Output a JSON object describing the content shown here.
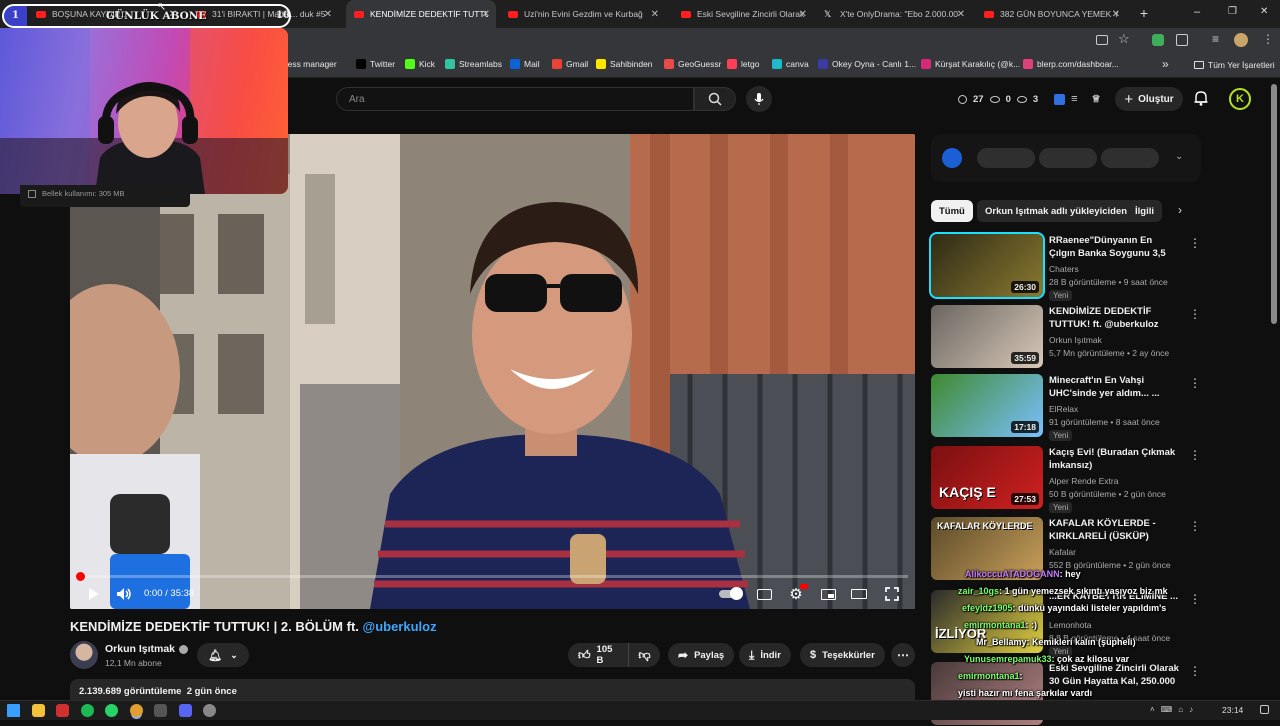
{
  "browser": {
    "tabs": [
      {
        "label": "BOŞUNA KAYDIR..."
      },
      {
        "label": "31'i BIRAKTI | Madal... duk #5"
      },
      {
        "label": "KENDİMİZE DEDEKTİF TUTTUK"
      },
      {
        "label": "Uzi'nin Evini Gezdim ve Kurbağ"
      },
      {
        "label": "Eski Sevgiline Zincirli Olarak 30"
      },
      {
        "label": "X'te OnlyDrama: \"Ebo 2.000.00"
      },
      {
        "label": "382 GÜN BOYUNCA YEMEK YE"
      }
    ],
    "new_tab": "+",
    "window_controls": {
      "minimize": "–",
      "restore": "❐",
      "close": "✕"
    },
    "bookmarks": [
      {
        "label": "usiness manager",
        "icon": "business-icon",
        "color": "#4a4a4a"
      },
      {
        "label": "Twitter",
        "icon": "x-icon",
        "color": "#000000"
      },
      {
        "label": "Kick",
        "icon": "kick-icon",
        "color": "#53fc18"
      },
      {
        "label": "Streamlabs",
        "icon": "streamlabs-icon",
        "color": "#31c3a2"
      },
      {
        "label": "Mail",
        "icon": "mail-icon",
        "color": "#0a64d6"
      },
      {
        "label": "Gmail",
        "icon": "gmail-icon",
        "color": "#ea4335"
      },
      {
        "label": "Sahibinden",
        "icon": "sahibinden-icon",
        "color": "#ffe800"
      },
      {
        "label": "GeoGuessr",
        "icon": "geoguessr-icon",
        "color": "#e94a4a"
      },
      {
        "label": "letgo",
        "icon": "letgo-icon",
        "color": "#ff3f55"
      },
      {
        "label": "canva",
        "icon": "canva-icon",
        "color": "#20b8cd"
      },
      {
        "label": "Okey Oyna - Canlı 1...",
        "icon": "okey-icon",
        "color": "#3a3aa0"
      },
      {
        "label": "Kürşat Karakılıç (@k...",
        "icon": "instagram-icon",
        "color": "#d62976"
      },
      {
        "label": "blerp.com/dashboar...",
        "icon": "blerp-icon",
        "color": "#e0407a"
      }
    ],
    "bookmarks_more": "»",
    "all_bookmarks": "Tüm Yer İşaretleri"
  },
  "overlay": {
    "banner_left_num": "1",
    "banner_text": "GÜNLÜK ABONE",
    "banner_right_num": "10",
    "memory_text": "Bellek kullanımı: 305 MB"
  },
  "youtube": {
    "search_placeholder": "Ara",
    "stats": {
      "a": "27",
      "b": "0",
      "c": "3"
    },
    "create_label": "Oluştur",
    "avatar_letter": "K",
    "player": {
      "time": "0:00 / 35:38",
      "progress": 0.0
    },
    "title_main": "KENDİMİZE DEDEKTİF TUTTUK! | 2. BÖLÜM ft. ",
    "title_mention": "@uberkuloz",
    "channel": {
      "name": "Orkun Işıtmak",
      "subs": "12,1 Mn abone"
    },
    "actions": {
      "likes": "105 B",
      "share": "Paylaş",
      "download": "İndir",
      "thanks": "Teşekkürler"
    },
    "description_meta": "2.139.689 görüntüleme  2 gün önce",
    "chips": [
      "Tümü",
      "Orkun Işıtmak adlı yükleyiciden",
      "İlgili"
    ],
    "recommendations": [
      {
        "title": "RRaenee\"Dünyanın En Çılgın Banka Soygunu 3,5 Ton Para ...",
        "channel": "Chaters",
        "meta": "28 B görüntüleme • 9 saat önce",
        "badge": "Yeni",
        "duration": "26:30",
        "colors": [
          "#2e2a16",
          "#8a7a30"
        ]
      },
      {
        "title": "KENDİMİZE DEDEKTİF TUTTUK! ft. @uberkuloz",
        "channel": "Orkun Işıtmak",
        "meta": "5,7 Mn görüntüleme • 2 ay önce",
        "badge": "",
        "duration": "35:59",
        "colors": [
          "#6b6560",
          "#d8c9b8"
        ]
      },
      {
        "title": "Minecraft'ın En Vahşi UHC'sinde yer aldım... ...",
        "channel": "ElRelax",
        "meta": "91 görüntüleme • 8 saat önce",
        "badge": "Yeni",
        "duration": "17:18",
        "colors": [
          "#3f8a2f",
          "#79c0ff"
        ]
      },
      {
        "title": "Kaçış Evi! (Buradan Çıkmak İmkansız)",
        "channel": "Alper Rende Extra",
        "meta": "50 B görüntüleme • 2 gün önce",
        "badge": "Yeni",
        "duration": "27:53",
        "colors": [
          "#7a1010",
          "#d02020"
        ]
      },
      {
        "title": "KAFALAR KÖYLERDE - KIRKLARELİ (ÜSKÜP)",
        "channel": "Kafalar",
        "meta": "552 B görüntüleme • 2 gün önce",
        "badge": "",
        "duration": "",
        "colors": [
          "#5a4a2a",
          "#caa05a"
        ]
      },
      {
        "title": "...ER KAYBETTİN ELİMİNE ...",
        "channel": "Lemonhota",
        "meta": "8,8 B görüntüleme • 4 saat önce",
        "badge": "Yeni",
        "duration": "",
        "colors": [
          "#2a2a2a",
          "#e0d040"
        ]
      },
      {
        "title": "Eski Sevgiline Zincirli Olarak 30 Gün Hayatta Kal, 250.000 Dola...",
        "channel": "",
        "meta": "",
        "badge": "",
        "duration": "",
        "colors": [
          "#4a3a3a",
          "#b08080"
        ]
      }
    ],
    "kafalar_thumb_text": "KAFALAR KÖYLERDE",
    "kacis_thumb_text": "KAÇIŞ E",
    "izliyor_text": "İZLİYOR"
  },
  "chat": [
    {
      "user": "AlikoccuATADOGANN",
      "msg": ": hey",
      "color": "#c77dff"
    },
    {
      "user": "zair_10gs",
      "msg": ": 1 gün yemezsek sıkıntı yaşıyoz biz mk",
      "color": "#7cff6b"
    },
    {
      "user": "efeyldz1905",
      "msg": ": dünkü yayındaki listeler yapıldım's",
      "color": "#7cff6b"
    },
    {
      "user": "emirmontana1",
      "msg": ": :)",
      "color": "#7cff6b"
    },
    {
      "user": "Mr_Bellamy",
      "msg": ": Kemikleri kalın (şüpheli)",
      "color": "#ffffff"
    },
    {
      "user": "Yunusemrepamuk33",
      "msg": ": çok az kilosu var",
      "color": "#7cff6b"
    },
    {
      "user": "emirmontana1",
      "msg": ":",
      "color": "#7cff6b"
    },
    {
      "user": "",
      "msg": "yisti hazır mı fena şarkılar vardı",
      "color": "#ffffff"
    }
  ],
  "taskbar": {
    "time": "23:14",
    "apps": [
      {
        "icon": "windows-icon",
        "color": "#3aa0ff"
      },
      {
        "icon": "explorer-icon",
        "color": "#f3c13a"
      },
      {
        "icon": "app-red-icon",
        "color": "#d03030"
      },
      {
        "icon": "spotify-icon",
        "color": "#1db954"
      },
      {
        "icon": "whatsapp-icon",
        "color": "#25d366"
      },
      {
        "icon": "chrome-icon",
        "color": "#e0a030"
      },
      {
        "icon": "obs-icon",
        "color": "#555555"
      },
      {
        "icon": "discord-icon",
        "color": "#5865f2"
      },
      {
        "icon": "steam-icon",
        "color": "#888888"
      }
    ]
  }
}
